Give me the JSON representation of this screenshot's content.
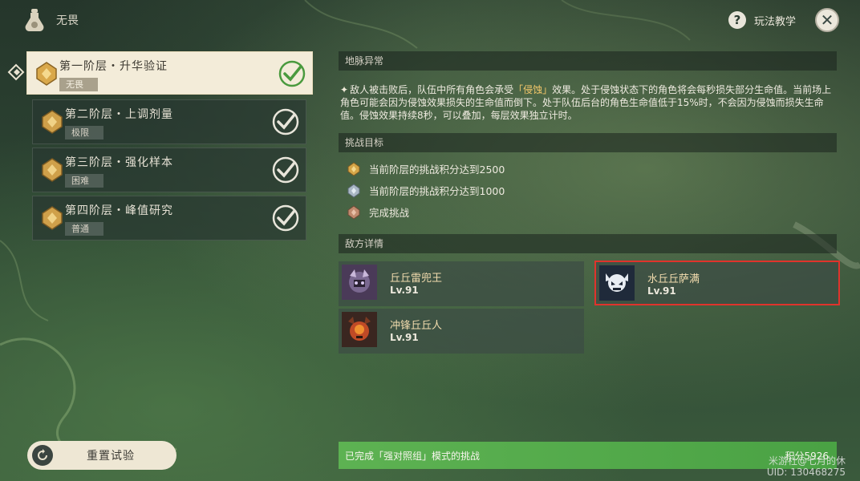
{
  "header": {
    "title": "无畏",
    "help_label": "玩法教学",
    "close_glyph": "✕"
  },
  "stages": [
    {
      "title": "第一阶层・升华验证",
      "difficulty": "无畏",
      "completed": true,
      "active": true
    },
    {
      "title": "第二阶层・上调剂量",
      "difficulty": "极限",
      "completed": true,
      "active": false
    },
    {
      "title": "第三阶层・强化样本",
      "difficulty": "困难",
      "completed": true,
      "active": false
    },
    {
      "title": "第四阶层・峰值研究",
      "difficulty": "普通",
      "completed": true,
      "active": false
    }
  ],
  "anomaly": {
    "heading": "地脉异常",
    "bullet": "✦",
    "text_before": "敌人被击败后，队伍中所有角色会承受",
    "highlight": "「侵蚀」",
    "text_after": "效果。处于侵蚀状态下的角色将会每秒损失部分生命值。当前场上角色可能会因为侵蚀效果损失的生命值而倒下。处于队伍后台的角色生命值低于15%时，不会因为侵蚀而损失生命值。侵蚀效果持续8秒，可以叠加，每层效果独立计时。"
  },
  "goals": {
    "heading": "挑战目标",
    "items": [
      {
        "text": "当前阶层的挑战积分达到2500",
        "icon": "gold-medal-icon"
      },
      {
        "text": "当前阶层的挑战积分达到1000",
        "icon": "silver-medal-icon"
      },
      {
        "text": "完成挑战",
        "icon": "bronze-medal-icon"
      }
    ]
  },
  "enemies": {
    "heading": "敌方详情",
    "items": [
      {
        "name": "丘丘雷兜王",
        "level": "Lv.91",
        "icon": "lawachurl-portrait"
      },
      {
        "name": "水丘丘萨满",
        "level": "Lv.91",
        "icon": "hydro-samachurl-portrait",
        "selected": true
      },
      {
        "name": "冲锋丘丘人",
        "level": "Lv.91",
        "icon": "berserker-hilichurl-portrait"
      }
    ]
  },
  "reset_button": "重置试验",
  "completion": {
    "text": "已完成「强对照组」模式的挑战",
    "score": "积分5926"
  },
  "watermark": {
    "line1": "米游社@七月的休",
    "line2": "UID: 130468275"
  },
  "colors": {
    "highlight": "#f3c76a",
    "selected_border": "#e0332c",
    "completion_bar": "#5db252",
    "check": "#4a9a3e"
  }
}
